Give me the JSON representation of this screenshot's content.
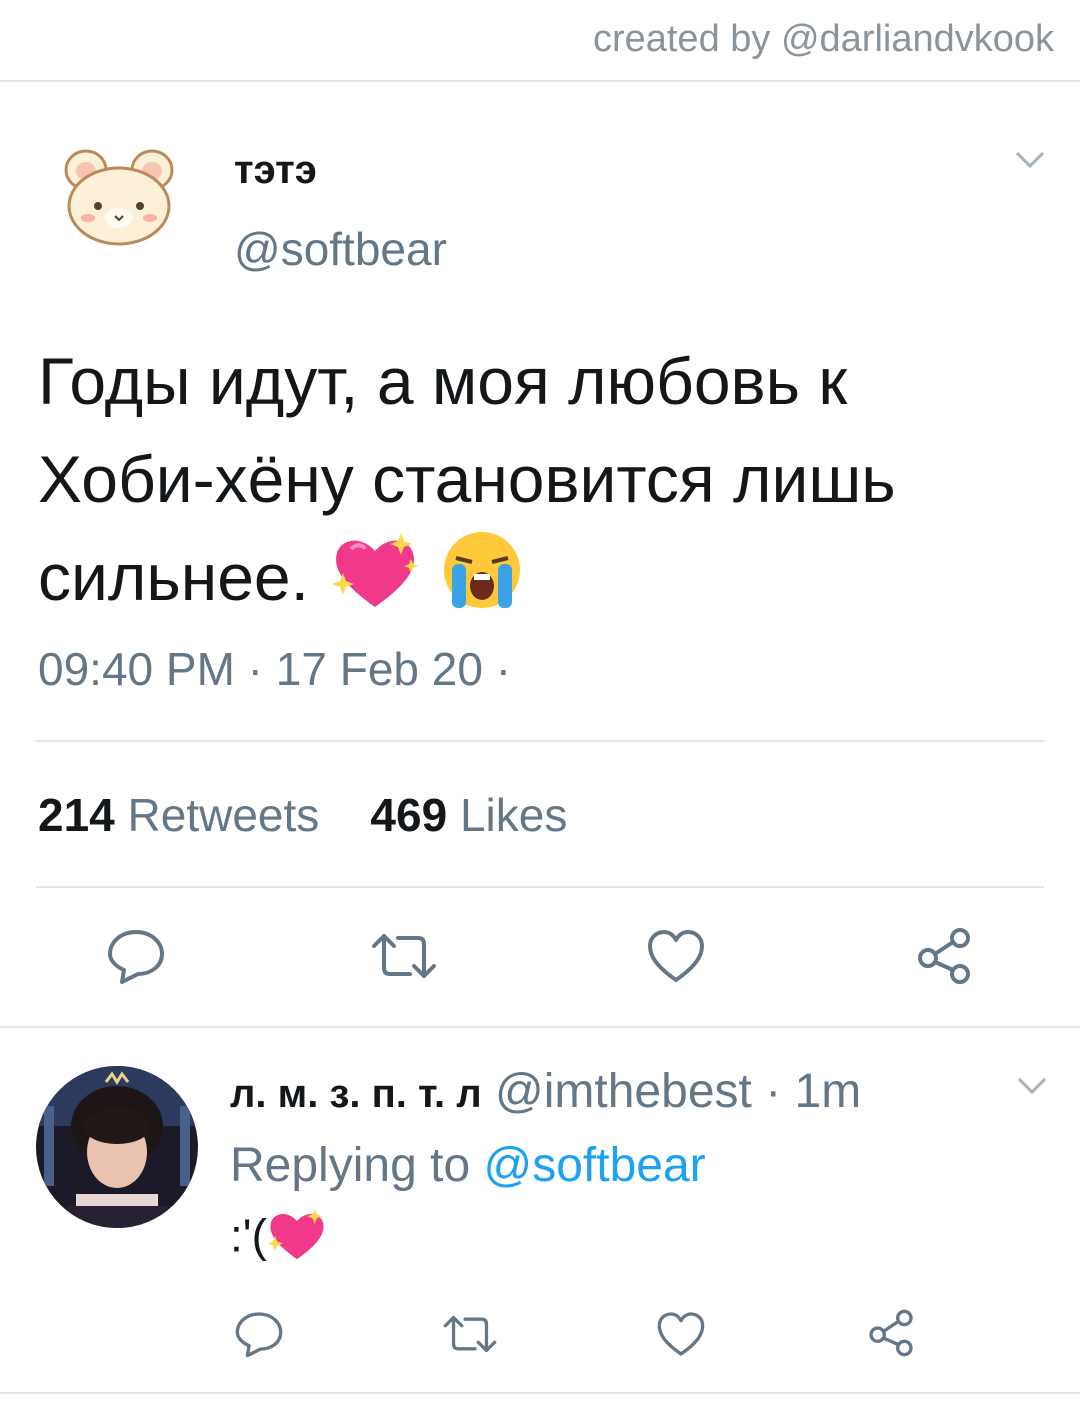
{
  "credit": "created by @darliandvkook",
  "tweet": {
    "name": "тэтэ",
    "handle": "@softbear",
    "text_line1": "Годы идут, а моя любовь к",
    "text_line2": "Хоби-хёну становится лишь",
    "text_line3": "сильнее.",
    "emojis": [
      "sparkling-heart",
      "loudly-crying-face"
    ],
    "time": "09:40 PM · 17 Feb 20 ·",
    "retweets_count": "214",
    "retweets_label": "Retweets",
    "likes_count": "469",
    "likes_label": "Likes"
  },
  "reply": {
    "name": "л. м. з. п. т. л",
    "handle": "@imthebest",
    "time": "· 1m",
    "replying_prefix": "Replying to",
    "replying_mention": "@softbear",
    "text": ":'(",
    "emoji": "sparkling-heart"
  },
  "icons": [
    "chevron-down-icon",
    "reply-icon",
    "retweet-icon",
    "like-icon",
    "share-icon"
  ],
  "colors": {
    "text": "#14171a",
    "secondary": "#657786",
    "link": "#1da1f2",
    "divider": "#e1e8ed",
    "heart": "#f0398a"
  }
}
